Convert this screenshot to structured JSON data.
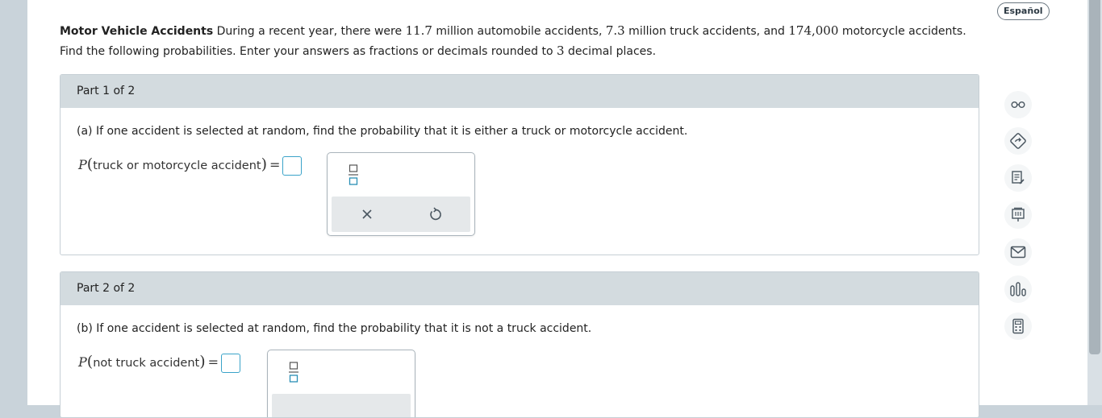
{
  "language_button": "Español",
  "intro": {
    "title": "Motor Vehicle Accidents",
    "text_1": " During a recent year, there were ",
    "num_car": "11.7",
    "text_2": " million automobile accidents, ",
    "num_truck": "7.3",
    "text_3": " million truck accidents, and ",
    "num_moto": "174,000",
    "text_4": " motorcycle accidents.",
    "line2_a": "Find the following probabilities. Enter your answers as fractions or decimals rounded to ",
    "line2_num": "3",
    "line2_b": " decimal places."
  },
  "part1": {
    "header": "Part 1 of 2",
    "question": "(a) If one accident is selected at random, find the probability that it is either a truck or motorcycle accident.",
    "eq_P": "P",
    "eq_text": "truck or motorcycle accident",
    "answer": ""
  },
  "part2": {
    "header": "Part 2 of 2",
    "question": "(b) If one accident is selected at random, find the probability that it is not a truck accident.",
    "eq_P": "P",
    "eq_text": "not truck accident",
    "answer": ""
  },
  "sidebar_icons": [
    "glasses-icon",
    "compass-icon",
    "notes-icon",
    "whiteboard-icon",
    "mail-icon",
    "chart-icon",
    "calculator-icon"
  ],
  "colors": {
    "accent": "#3aa3c9",
    "header_bg": "#d3dbdf",
    "outer_bg": "#c9d3da"
  }
}
